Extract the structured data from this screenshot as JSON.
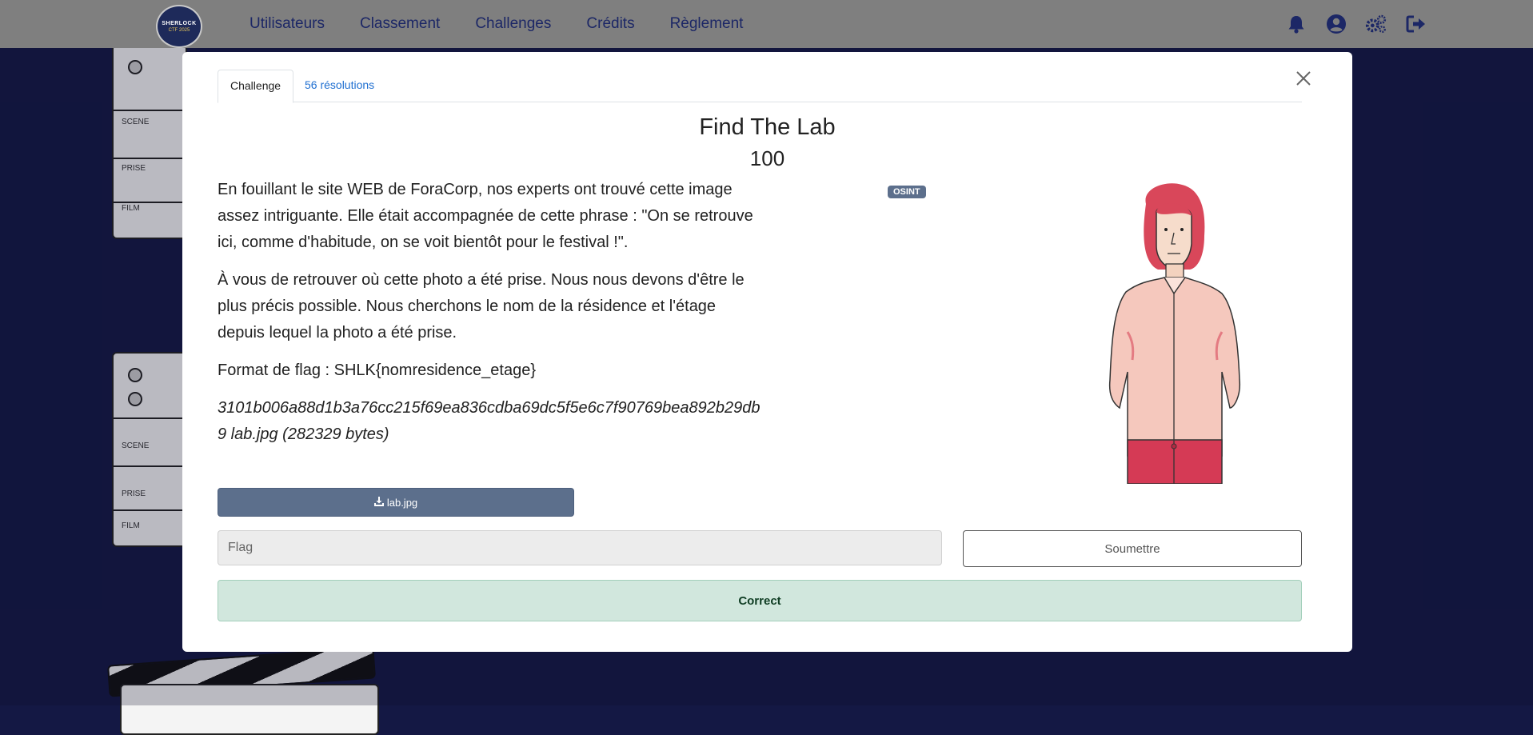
{
  "navbar": {
    "logo": {
      "line1": "SHERLOCK",
      "line2": "CTF 2025"
    },
    "links": [
      "Utilisateurs",
      "Classement",
      "Challenges",
      "Crédits",
      "Règlement"
    ],
    "icons": [
      "bell-icon",
      "user-circle-icon",
      "gears-icon",
      "sign-out-icon"
    ]
  },
  "modal": {
    "tabs": {
      "challenge": "Challenge",
      "solves": "56 résolutions"
    },
    "title": "Find The Lab",
    "points": "100",
    "tag": "OSINT",
    "description": {
      "p1": "En fouillant le site WEB de ForaCorp, nos experts ont trouvé cette image assez intriguante. Elle était accompagnée de cette phrase : \"On se retrouve ici, comme d'habitude, on se voit bientôt pour le festival !\".",
      "p2": "À vous de retrouver où cette photo a été prise. Nous nous devons d'être le plus précis possible. Nous cherchons le nom de la résidence et l'étage depuis lequel la photo a été prise.",
      "p3": "Format de flag : SHLK{nomresidence_etage}",
      "hash": "3101b006a88d1b3a76cc215f69ea836cdba69dc5f5e6c7f90769bea892b29db9 lab.jpg (282329 bytes)"
    },
    "download_label": "lab.jpg",
    "flag_placeholder": "Flag",
    "submit_label": "Soumettre",
    "result_message": "Correct"
  },
  "background": {
    "clapper_labels": [
      "SCENE",
      "PRISE",
      "FILM"
    ]
  },
  "colors": {
    "page_bg": "#141844",
    "navbar_bg": "#7f7f7f",
    "nav_link": "#1c2766",
    "tag_bg": "#5c6f8c",
    "success_bg": "#d1e7dd"
  }
}
